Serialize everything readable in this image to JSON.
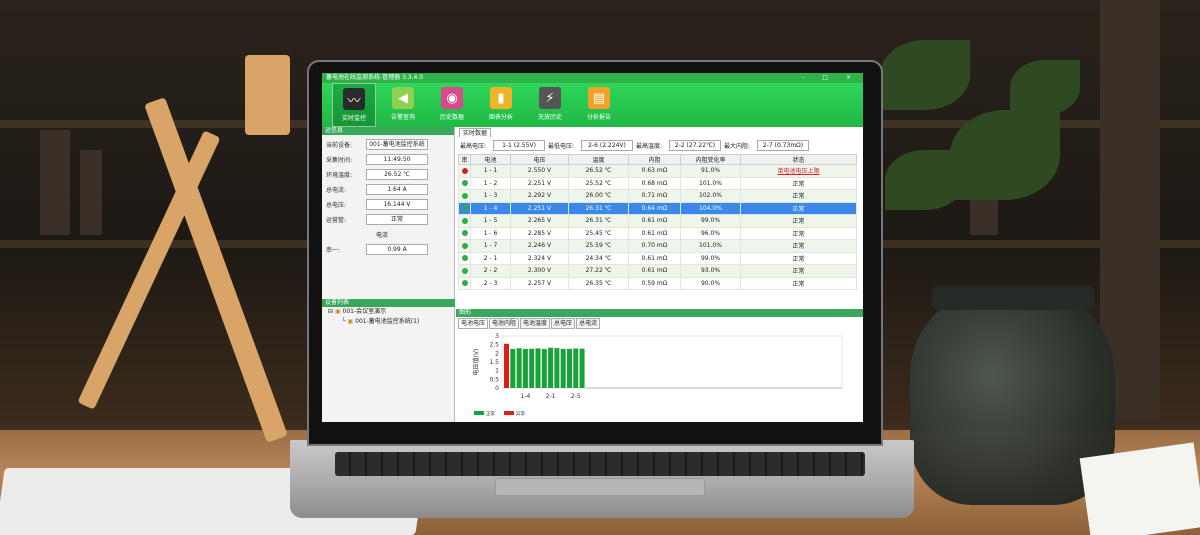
{
  "app": {
    "title": "蓄电池在线监测系统-管理器 3.3.4.0",
    "window_controls": "- □ ×"
  },
  "toolbar": {
    "items": [
      {
        "label": "实时监控",
        "icon": "monitor-icon",
        "active": true
      },
      {
        "label": "告警查询",
        "icon": "speaker-icon"
      },
      {
        "label": "历史数据",
        "icon": "database-icon"
      },
      {
        "label": "图表分析",
        "icon": "bar-chart-icon"
      },
      {
        "label": "充放历史",
        "icon": "battery-icon"
      },
      {
        "label": "分析报告",
        "icon": "report-icon"
      }
    ]
  },
  "info": {
    "header": "运信息",
    "rows": [
      {
        "label": "当前设备:",
        "value": "001-蓄电池监控系统"
      },
      {
        "label": "采集时间:",
        "value": "11:49:50"
      },
      {
        "label": "环境温度:",
        "value": "26.52 ℃"
      },
      {
        "label": "总电流:",
        "value": "1.64 A"
      },
      {
        "label": "总电压:",
        "value": "16.144 V"
      },
      {
        "label": "运营管:",
        "value": "正常"
      }
    ],
    "current_section": "电流",
    "current_rows": [
      {
        "label": "串一:",
        "value": "0.99 A"
      }
    ]
  },
  "device_list": {
    "header": "设备列表",
    "items": [
      "001-会议室演示",
      "001-蓄电池监控系统(1)"
    ]
  },
  "realtime": {
    "tab": "实时数据",
    "summary": [
      {
        "label": "最高电压:",
        "value": "1-1 (2.55V)"
      },
      {
        "label": "最低电压:",
        "value": "2-6 (2.224V)"
      },
      {
        "label": "最高温度:",
        "value": "2-2 (27.22℃)"
      },
      {
        "label": "最大内阻:",
        "value": "2-7 (0.73mΩ)"
      }
    ],
    "columns": [
      "串",
      "电池",
      "电压",
      "温度",
      "内阻",
      "内阻变化率",
      "状态"
    ],
    "rows": [
      {
        "group": "1",
        "cell": "- 1",
        "voltage": "2.550 V",
        "temp": "26.52 ℃",
        "resistance": "0.63 mΩ",
        "rate": "91.0%",
        "status": "单电池电压上限",
        "alarm": true
      },
      {
        "group": "1",
        "cell": "- 2",
        "voltage": "2.251 V",
        "temp": "25.52 ℃",
        "resistance": "0.68 mΩ",
        "rate": "101.0%",
        "status": "正常"
      },
      {
        "group": "1",
        "cell": "- 3",
        "voltage": "2.292 V",
        "temp": "26.00 ℃",
        "resistance": "0.71 mΩ",
        "rate": "102.0%",
        "status": "正常"
      },
      {
        "group": "1",
        "cell": "- 4",
        "voltage": "2.251 V",
        "temp": "26.31 ℃",
        "resistance": "0.64 mΩ",
        "rate": "104.0%",
        "status": "正常",
        "selected": true
      },
      {
        "group": "1",
        "cell": "- 5",
        "voltage": "2.265 V",
        "temp": "26.31 ℃",
        "resistance": "0.61 mΩ",
        "rate": "99.0%",
        "status": "正常"
      },
      {
        "group": "1",
        "cell": "- 6",
        "voltage": "2.285 V",
        "temp": "25.45 ℃",
        "resistance": "0.61 mΩ",
        "rate": "96.0%",
        "status": "正常"
      },
      {
        "group": "1",
        "cell": "- 7",
        "voltage": "2.246 V",
        "temp": "25.59 ℃",
        "resistance": "0.70 mΩ",
        "rate": "101.0%",
        "status": "正常"
      },
      {
        "group": "2",
        "cell": "- 1",
        "voltage": "2.324 V",
        "temp": "24.34 ℃",
        "resistance": "0.61 mΩ",
        "rate": "99.0%",
        "status": "正常"
      },
      {
        "group": "2",
        "cell": "- 2",
        "voltage": "2.300 V",
        "temp": "27.22 ℃",
        "resistance": "0.61 mΩ",
        "rate": "93.0%",
        "status": "正常"
      },
      {
        "group": "2",
        "cell": "- 3",
        "voltage": "2.257 V",
        "temp": "26.35 ℃",
        "resistance": "0.59 mΩ",
        "rate": "90.0%",
        "status": "正常"
      }
    ]
  },
  "graph": {
    "header": "图形",
    "tabs": [
      "电池电压",
      "电池内阻",
      "电池温度",
      "总电压",
      "总电流"
    ],
    "active_tab": 0
  },
  "chart_data": {
    "type": "bar",
    "ylabel": "电压值(V)",
    "ylim": [
      0,
      3
    ],
    "yticks": [
      "0",
      "0.5",
      "1",
      "1.5",
      "2",
      "2.5",
      "3"
    ],
    "xticks": [
      "1-4",
      "2-1",
      "2-5"
    ],
    "values": [
      2.55,
      2.251,
      2.292,
      2.251,
      2.265,
      2.285,
      2.246,
      2.324,
      2.3,
      2.257,
      2.26,
      2.28,
      2.27
    ],
    "alarm_index": [
      0
    ],
    "colors": {
      "normal": "#18a33a",
      "alarm": "#e01b1b"
    },
    "legend": [
      {
        "name": "正常",
        "color": "#18a33a"
      },
      {
        "name": "异常",
        "color": "#e01b1b"
      }
    ],
    "slots": 54
  }
}
